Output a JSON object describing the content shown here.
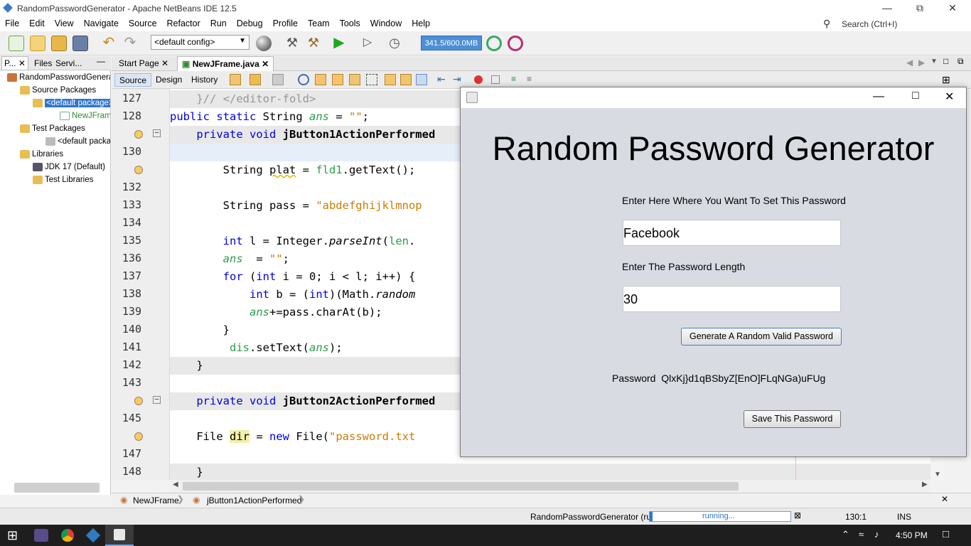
{
  "window": {
    "title": "RandomPasswordGenerator - Apache NetBeans IDE 12.5"
  },
  "menu": [
    "File",
    "Edit",
    "View",
    "Navigate",
    "Source",
    "Refactor",
    "Run",
    "Debug",
    "Profile",
    "Team",
    "Tools",
    "Window",
    "Help"
  ],
  "search": {
    "placeholder": "Search (Ctrl+I)"
  },
  "toolbar": {
    "config": "<default config>",
    "memory": "341.5/600.0MB"
  },
  "left_tabs": [
    "P...",
    "Files",
    "Servi..."
  ],
  "tree": {
    "project": "RandomPasswordGenerator",
    "source_packages": "Source Packages",
    "default_pkg": "<default package>",
    "file": "NewJFrame.java",
    "test_packages": "Test Packages",
    "default_pkg2": "<default package>",
    "libraries": "Libraries",
    "jdk": "JDK 17 (Default)",
    "test_libraries": "Test Libraries"
  },
  "editor_tabs": [
    "Start Page",
    "NewJFrame.java"
  ],
  "view_tabs": [
    "Source",
    "Design",
    "History"
  ],
  "line_numbers": [
    "127",
    "128",
    "",
    "130",
    "",
    "132",
    "133",
    "134",
    "135",
    "136",
    "137",
    "138",
    "139",
    "140",
    "141",
    "142",
    "143",
    "",
    "145",
    "",
    "147",
    "148"
  ],
  "code": [
    "    }// </editor-fold>",
    "public static String ans = \"\";",
    "    private void jButton1ActionPerformed",
    "",
    "        String plat = fld1.getText();",
    "",
    "        String pass = \"abdefghijklmnop",
    "",
    "        int l = Integer.parseInt(len.",
    "        ans  = \"\";",
    "        for (int i = 0; i < l; i++) {",
    "            int b = (int)(Math.random",
    "            ans+=pass.charAt(b);",
    "        }",
    "         dis.setText(ans);",
    "    }",
    "",
    "    private void jButton2ActionPerformed",
    "",
    "    File dir = new File(\"password.txt",
    "",
    "    }"
  ],
  "navbar": {
    "class": "NewJFrame",
    "method": "jButton1ActionPerformed"
  },
  "status": {
    "run": "RandomPasswordGenerator (run)",
    "progress": "running...",
    "position": "130:1",
    "mode": "INS"
  },
  "taskbar": {
    "time": "4:50 PM"
  },
  "dialog": {
    "heading": "Random Password Generator",
    "label_where": "Enter Here Where You Want To Set This Password",
    "where_value": "Facebook",
    "label_length": "Enter The Password Length",
    "length_value": "30",
    "generate_button": "Generate A Random Valid Password",
    "password_label": "Password",
    "password_value": "QlxKj}d1qBSbyZ[EnO]FLqNGa)uFUg",
    "save_button": "Save This Password"
  },
  "colors": {
    "accent": "#2d75d1",
    "keyword": "#0000e6",
    "string": "#ce7b00",
    "dialog_bg": "#d8dce2"
  }
}
